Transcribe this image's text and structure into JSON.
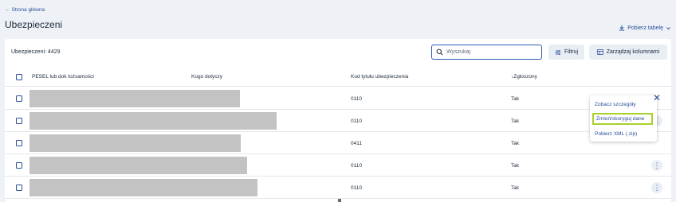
{
  "nav": {
    "back_icon": "arrow-left-icon",
    "back_label": "Strona główna"
  },
  "page": {
    "title": "Ubezpieczeni",
    "download_label": "Pobierz tabelę",
    "download_icon": "download-icon",
    "download_chevron": "chevron-down-icon"
  },
  "toolbar": {
    "count_label": "Ubezpieczeni: ",
    "count_value": "4429",
    "search_placeholder": "Wyszukaj",
    "filter_label": "Filtruj",
    "columns_label": "Zarządzaj kolumnami"
  },
  "table": {
    "headers": {
      "pesel": "PESEL lub dok tożsamości",
      "who": "Kogo dotyczy",
      "code": "Kod tytułu ubezpieczenia",
      "reported": "Zgłoszony"
    },
    "sort_indicator": "↓",
    "rows": [
      {
        "code": "0110",
        "reported": "Tak"
      },
      {
        "code": "0110",
        "reported": "Tak"
      },
      {
        "code": "0411",
        "reported": "Tak"
      },
      {
        "code": "0110",
        "reported": "Tak"
      },
      {
        "code": "0110",
        "reported": "Tak"
      }
    ]
  },
  "context_menu": {
    "items": [
      "Zobacz szczegóły",
      "Zmień/skoryguj dane",
      "Pobierz XML (.zip)"
    ],
    "highlight_color": "#a8d22e",
    "close_icon": "close-icon"
  },
  "colors": {
    "accent": "#2a4f9a",
    "background": "#eef1f6",
    "redaction": "#c3c3c3"
  }
}
